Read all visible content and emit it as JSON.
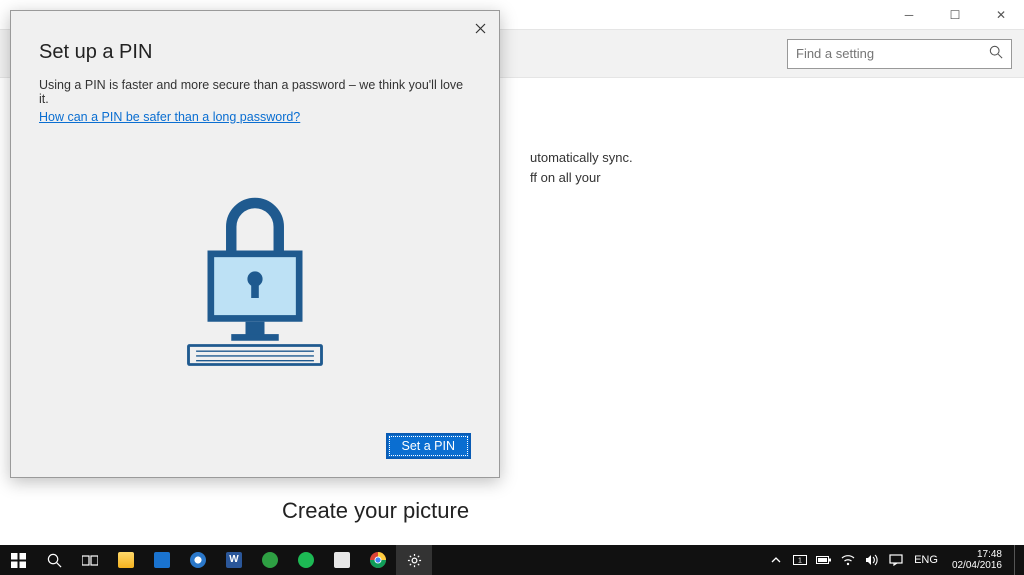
{
  "settings": {
    "title": "Settings",
    "search_placeholder": "Find a setting",
    "body_text_line1": "utomatically sync.",
    "body_text_line2": "ff on all your",
    "bottom_heading": "Create your picture"
  },
  "dialog": {
    "title": "Set up a PIN",
    "description": "Using a PIN is faster and more secure than a password – we think you'll love it.",
    "link": "How can a PIN be safer than a long password?",
    "button": "Set a PIN"
  },
  "taskbar": {
    "lang": "ENG",
    "time": "17:48",
    "date": "02/04/2016"
  }
}
